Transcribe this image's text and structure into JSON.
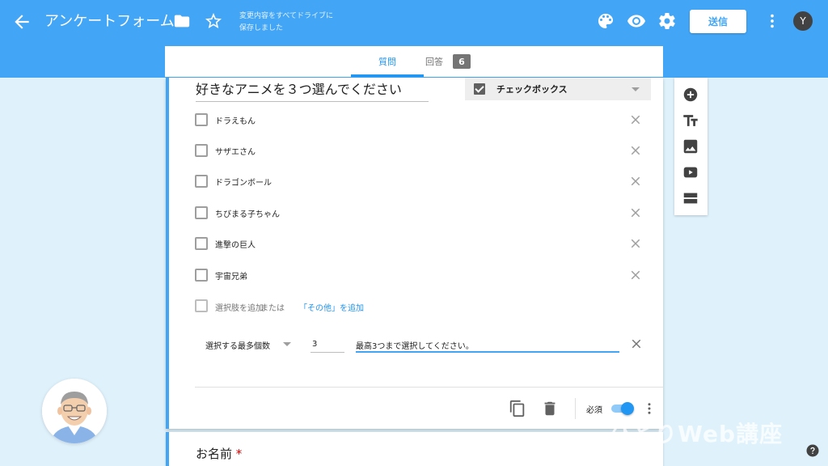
{
  "header": {
    "title": "アンケートフォーム",
    "saved_status_line1": "変更内容をすべてドライブに",
    "saved_status_line2": "保存しました",
    "send_label": "送信",
    "avatar_initial": "Y",
    "icons": [
      "back-arrow-icon",
      "folder-icon",
      "star-icon",
      "palette-icon",
      "eye-icon",
      "gear-icon",
      "more-vert-icon"
    ]
  },
  "tabs": {
    "questions": "質問",
    "responses": "回答",
    "responses_count": "6"
  },
  "question": {
    "title": "好きなアニメを３つ選んでください",
    "type_label": "チェックボックス",
    "options": [
      {
        "label": "ドラえもん"
      },
      {
        "label": "サザエさん"
      },
      {
        "label": "ドラゴンボール"
      },
      {
        "label": "ちびまる子ちゃん"
      },
      {
        "label": "進撃の巨人"
      },
      {
        "label": "宇宙兄弟"
      }
    ],
    "add_option": "選択肢を追加",
    "add_or": "または",
    "add_other": "「その他」を追加",
    "validation": {
      "rule_label": "選択する最多個数",
      "max_value": "3",
      "error_message": "最高3つまで選択してください。"
    },
    "required_label": "必須",
    "required": true
  },
  "next_question": {
    "title": "お名前",
    "required_mark": "*"
  },
  "side_tools": [
    "add-question-icon",
    "title-text-icon",
    "image-icon",
    "video-icon",
    "section-icon"
  ],
  "watermark": "ひとりWeb講座",
  "colors": {
    "header_bg": "#42a5f5",
    "accent": "#2196f3",
    "page_bg": "#dff1fb"
  }
}
